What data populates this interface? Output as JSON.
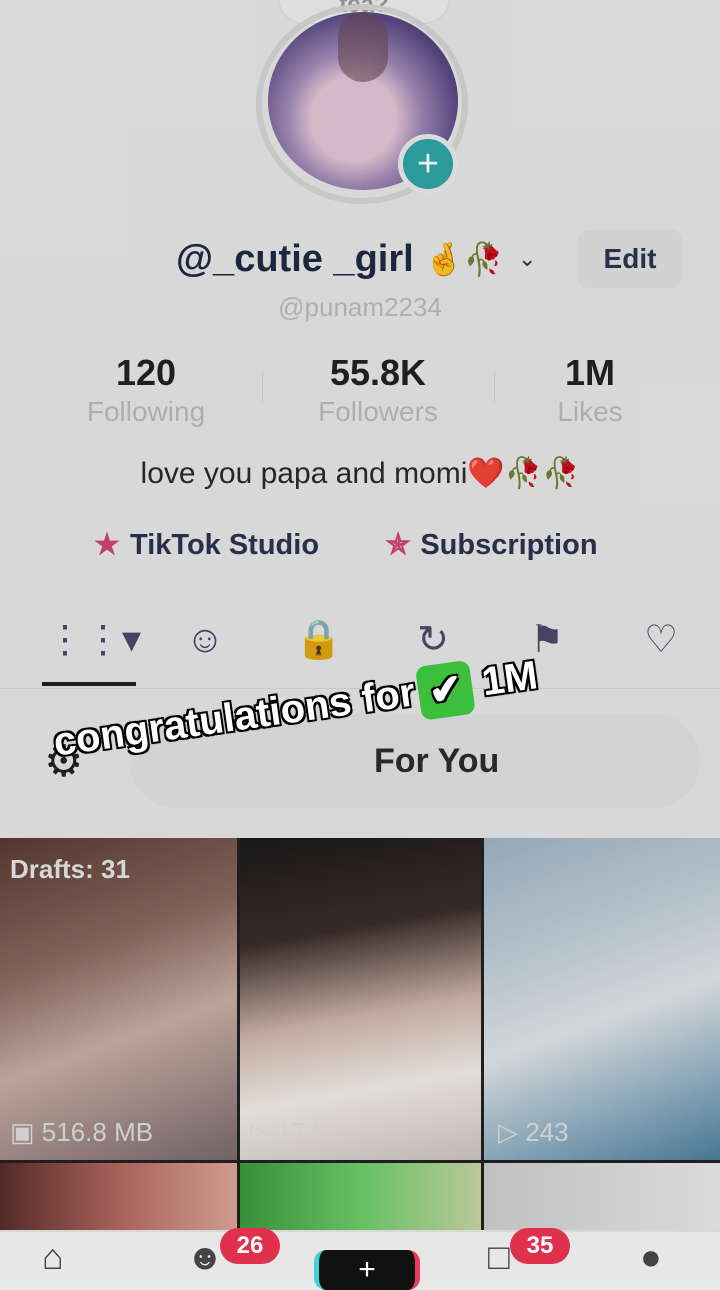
{
  "header": {
    "top_pill_text": "tea?",
    "display_name": "@_cutie _girl",
    "name_emoji": "🤞🥀",
    "edit_label": "Edit",
    "username": "@punam2234"
  },
  "stats": [
    {
      "value": "120",
      "label": "Following"
    },
    {
      "value": "55.8K",
      "label": "Followers"
    },
    {
      "value": "1M",
      "label": "Likes"
    }
  ],
  "bio": "love you papa and momi❤️🥀🥀",
  "links": {
    "studio_label": "TikTok Studio",
    "subscription_label": "Subscription"
  },
  "filter": {
    "label": "For You"
  },
  "caption": {
    "text_before": "congratulations for",
    "text_after": "1M"
  },
  "grid": {
    "drafts_label": "Drafts: 31",
    "drafts_size": "516.8 MB",
    "video2_views": "174",
    "video3_views": "243"
  },
  "nav": {
    "friends_badge": "26",
    "inbox_badge": "35"
  },
  "colors": {
    "accent_pink": "#e0304e",
    "accent_teal": "#2fa6a6"
  }
}
